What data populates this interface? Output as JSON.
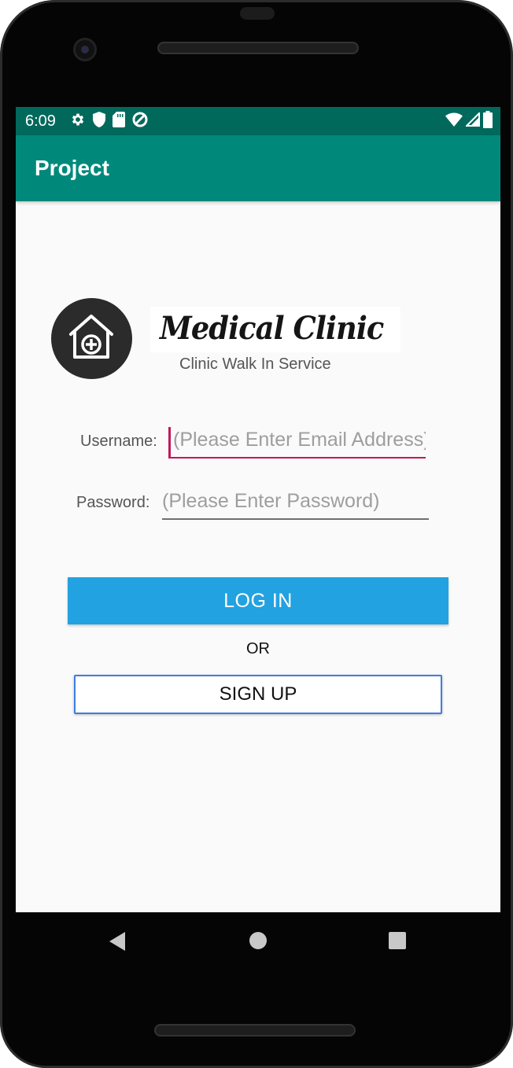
{
  "status_bar": {
    "time": "6:09",
    "left_icons": [
      "settings-icon",
      "shield-icon",
      "sd-card-icon",
      "data-saver-icon"
    ],
    "right_icons": [
      "wifi-icon",
      "signal-icon",
      "battery-icon"
    ]
  },
  "app_bar": {
    "title": "Project"
  },
  "logo": {
    "icon": "home-plus-icon",
    "brand": "Medical Clinic",
    "subtitle": "Clinic Walk In Service"
  },
  "form": {
    "username_label": "Username:",
    "username_placeholder": "(Please Enter Email Address)",
    "username_value": "",
    "password_label": "Password:",
    "password_placeholder": "(Please Enter Password)",
    "password_value": ""
  },
  "actions": {
    "login_label": "LOG IN",
    "or_text": "OR",
    "signup_label": "SIGN UP"
  },
  "colors": {
    "status_bar": "#00695c",
    "app_bar": "#00897b",
    "login_button": "#22a2e0",
    "focus_accent": "#c2185b"
  },
  "nav_bar": {
    "buttons": [
      "back-icon",
      "home-icon",
      "recents-icon"
    ]
  }
}
